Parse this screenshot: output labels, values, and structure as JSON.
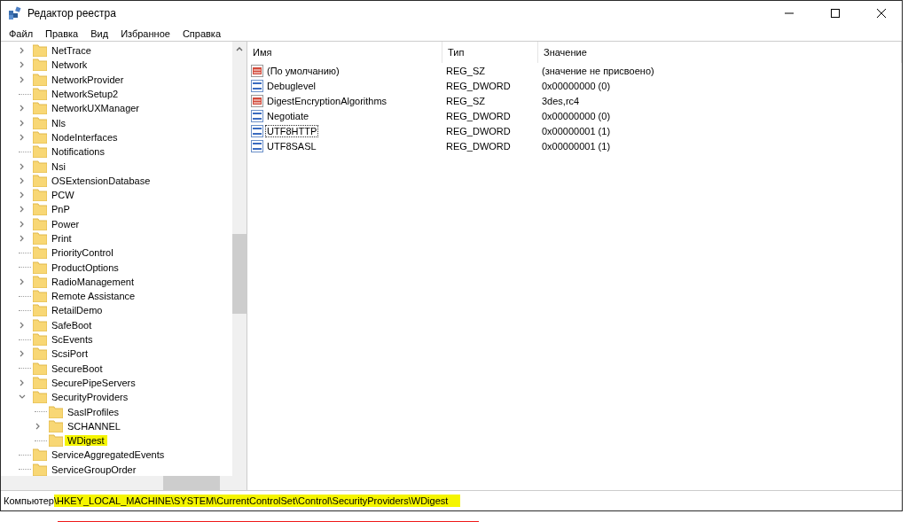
{
  "window": {
    "title": "Редактор реестра"
  },
  "menu": [
    "Файл",
    "Правка",
    "Вид",
    "Избранное",
    "Справка"
  ],
  "tree": [
    {
      "label": "NetTrace",
      "kind": "branch",
      "expanded": false,
      "selected": false
    },
    {
      "label": "Network",
      "kind": "branch",
      "expanded": false,
      "selected": false
    },
    {
      "label": "NetworkProvider",
      "kind": "branch",
      "expanded": false,
      "selected": false
    },
    {
      "label": "NetworkSetup2",
      "kind": "leaf",
      "selected": false
    },
    {
      "label": "NetworkUXManager",
      "kind": "branch",
      "expanded": false,
      "selected": false
    },
    {
      "label": "Nls",
      "kind": "branch",
      "expanded": false,
      "selected": false
    },
    {
      "label": "NodeInterfaces",
      "kind": "branch",
      "expanded": false,
      "selected": false
    },
    {
      "label": "Notifications",
      "kind": "leaf",
      "selected": false
    },
    {
      "label": "Nsi",
      "kind": "branch",
      "expanded": false,
      "selected": false
    },
    {
      "label": "OSExtensionDatabase",
      "kind": "branch",
      "expanded": false,
      "selected": false
    },
    {
      "label": "PCW",
      "kind": "branch",
      "expanded": false,
      "selected": false
    },
    {
      "label": "PnP",
      "kind": "branch",
      "expanded": false,
      "selected": false
    },
    {
      "label": "Power",
      "kind": "branch",
      "expanded": false,
      "selected": false
    },
    {
      "label": "Print",
      "kind": "branch",
      "expanded": false,
      "selected": false
    },
    {
      "label": "PriorityControl",
      "kind": "leaf",
      "selected": false
    },
    {
      "label": "ProductOptions",
      "kind": "leaf",
      "selected": false
    },
    {
      "label": "RadioManagement",
      "kind": "branch",
      "expanded": false,
      "selected": false
    },
    {
      "label": "Remote Assistance",
      "kind": "leaf",
      "selected": false
    },
    {
      "label": "RetailDemo",
      "kind": "leaf",
      "selected": false
    },
    {
      "label": "SafeBoot",
      "kind": "branch",
      "expanded": false,
      "selected": false
    },
    {
      "label": "ScEvents",
      "kind": "leaf",
      "selected": false
    },
    {
      "label": "ScsiPort",
      "kind": "branch",
      "expanded": false,
      "selected": false
    },
    {
      "label": "SecureBoot",
      "kind": "leaf",
      "selected": false
    },
    {
      "label": "SecurePipeServers",
      "kind": "branch",
      "expanded": false,
      "selected": false
    },
    {
      "label": "SecurityProviders",
      "kind": "branch",
      "expanded": true,
      "selected": false,
      "children": [
        {
          "label": "SaslProfiles",
          "kind": "leaf",
          "selected": false
        },
        {
          "label": "SCHANNEL",
          "kind": "branch",
          "expanded": false,
          "selected": false
        },
        {
          "label": "WDigest",
          "kind": "leaf",
          "selected": true,
          "highlighted": true
        }
      ]
    },
    {
      "label": "ServiceAggregatedEvents",
      "kind": "leaf",
      "selected": false
    },
    {
      "label": "ServiceGroupOrder",
      "kind": "leaf",
      "selected": false
    }
  ],
  "table": {
    "columns": [
      "Имя",
      "Тип",
      "Значение"
    ],
    "rows": [
      {
        "kind": "string",
        "name": "(По умолчанию)",
        "type": "REG_SZ",
        "value": "(значение не присвоено)",
        "focused": false
      },
      {
        "kind": "binary",
        "name": "Debuglevel",
        "type": "REG_DWORD",
        "value": "0x00000000 (0)",
        "focused": false
      },
      {
        "kind": "string",
        "name": "DigestEncryptionAlgorithms",
        "type": "REG_SZ",
        "value": "3des,rc4",
        "focused": false
      },
      {
        "kind": "binary",
        "name": "Negotiate",
        "type": "REG_DWORD",
        "value": "0x00000000 (0)",
        "focused": false
      },
      {
        "kind": "binary",
        "name": "UTF8HTTP",
        "type": "REG_DWORD",
        "value": "0x00000001 (1)",
        "focused": true
      },
      {
        "kind": "binary",
        "name": "UTF8SASL",
        "type": "REG_DWORD",
        "value": "0x00000001 (1)",
        "focused": false
      }
    ]
  },
  "status_bar": {
    "prefix": "Компьютер",
    "path": "\\HKEY_LOCAL_MACHINE\\SYSTEM\\CurrentControlSet\\Control\\SecurityProviders\\WDigest",
    "highlighted": true,
    "underlined": true
  }
}
